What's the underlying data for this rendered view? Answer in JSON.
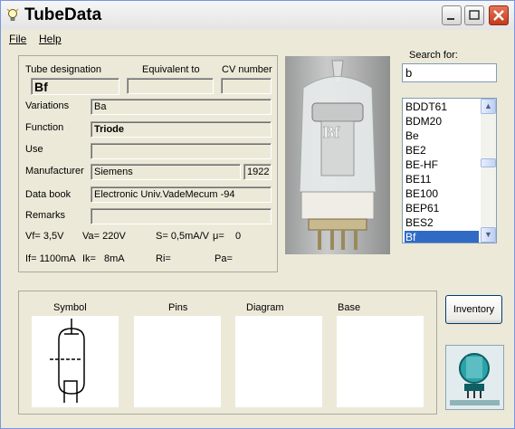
{
  "app": {
    "title": "TubeData"
  },
  "menu": [
    "File",
    "Help"
  ],
  "fields": {
    "tube_designation_label": "Tube designation",
    "equivalent_label": "Equivalent to",
    "cv_label": "CV number",
    "tube_designation": "Bf",
    "equivalent": "",
    "cv_number": "",
    "variations_label": "Variations",
    "variations": "Ba",
    "function_label": "Function",
    "function": "Triode",
    "use_label": "Use",
    "use": "",
    "manufacturer_label": "Manufacturer",
    "manufacturer": "Siemens",
    "year": "1922",
    "databook_label": "Data book",
    "databook": "Electronic Univ.VadeMecum -94",
    "remarks_label": "Remarks",
    "remarks": ""
  },
  "params": {
    "vf": "Vf= 3,5V",
    "va": "Va= 220V",
    "s": "S= 0,5mA/V",
    "mu": "μ=",
    "mu_val": "0",
    "if": "If= 1100mA",
    "ik": "Ik=",
    "ik_val": "8mA",
    "ri": "Ri=",
    "pa": "Pa="
  },
  "search": {
    "label": "Search for:",
    "value": "b"
  },
  "list": {
    "items": [
      "BDDT61",
      "BDM20",
      "Be",
      "BE2",
      "BE-HF",
      "BE11",
      "BE100",
      "BEP61",
      "BES2",
      "Bf"
    ],
    "selected": "Bf"
  },
  "bottom": {
    "symbol": "Symbol",
    "pins": "Pins",
    "diagram": "Diagram",
    "base": "Base"
  },
  "inventory_button": "Inventory",
  "photo": {
    "stamp_text": "Bf"
  },
  "colors": {
    "selection": "#316ac5",
    "window_bg": "#ece9d8",
    "close_button": "#c23b1c"
  }
}
